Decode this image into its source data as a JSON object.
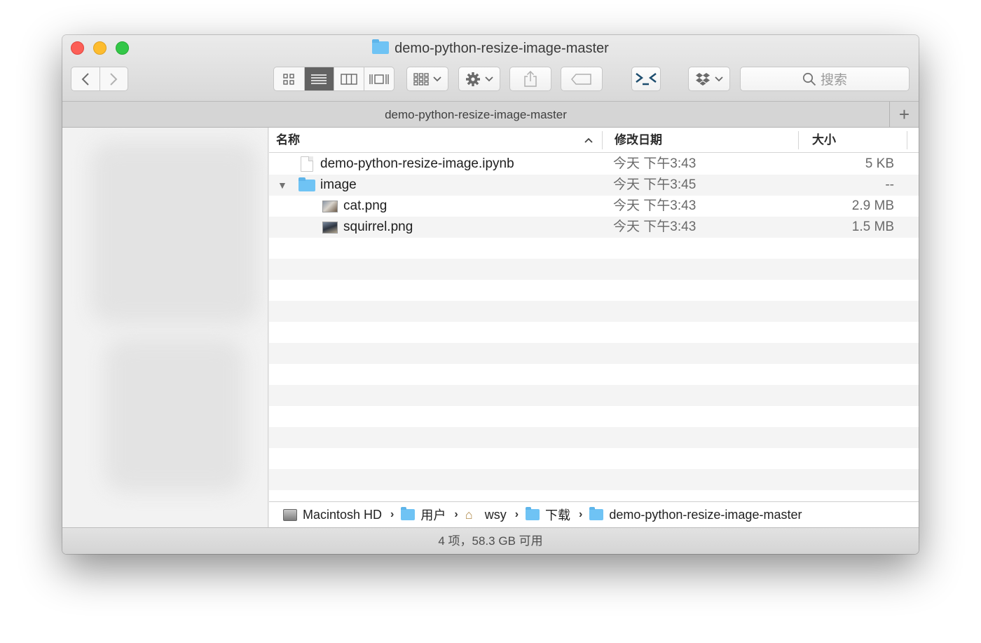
{
  "window": {
    "title": "demo-python-resize-image-master"
  },
  "toolbar": {
    "back_icon": "chevron-left-icon",
    "forward_icon": "chevron-right-icon",
    "view_modes": [
      "icon-view",
      "list-view",
      "column-view",
      "gallery-view"
    ],
    "active_view": "list-view",
    "search_placeholder": "搜索"
  },
  "tab": {
    "title": "demo-python-resize-image-master",
    "add_label": "+"
  },
  "columns": {
    "name": "名称",
    "date": "修改日期",
    "size": "大小"
  },
  "files": [
    {
      "name": "demo-python-resize-image.ipynb",
      "date": "今天 下午3:43",
      "size": "5 KB",
      "type": "document"
    },
    {
      "name": "image",
      "date": "今天 下午3:45",
      "size": "--",
      "type": "folder",
      "expanded": true
    },
    {
      "name": "cat.png",
      "date": "今天 下午3:43",
      "size": "2.9 MB",
      "type": "image"
    },
    {
      "name": "squirrel.png",
      "date": "今天 下午3:43",
      "size": "1.5 MB",
      "type": "image"
    }
  ],
  "path": {
    "items": [
      "Macintosh HD",
      "用户",
      "wsy",
      "下载",
      "demo-python-resize-image-master"
    ]
  },
  "status": {
    "text": "4 项，58.3 GB 可用"
  }
}
